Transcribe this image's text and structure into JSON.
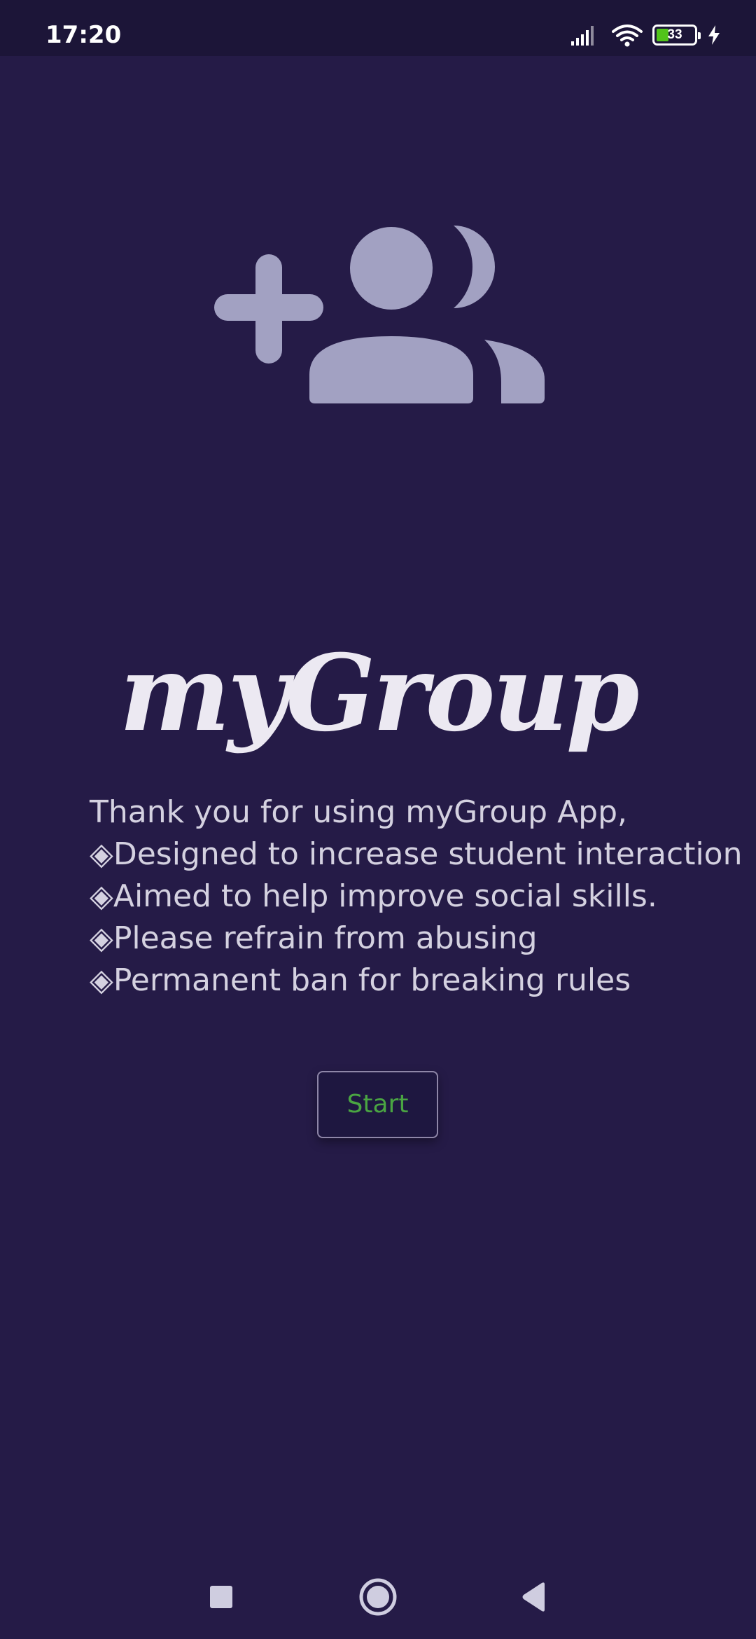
{
  "status_bar": {
    "time": "17:20",
    "battery_level": "33",
    "battery_fraction": 0.33,
    "icons": [
      "signal-icon",
      "wifi-icon",
      "battery-icon",
      "charging-bolt-icon"
    ]
  },
  "hero": {
    "icon": "group-add-icon",
    "icon_color": "#a2a1c2"
  },
  "logo": {
    "text": "myGroup"
  },
  "intro": {
    "lines": [
      "Thank you for using myGroup App,",
      "◈Designed to increase student interaction",
      "◈Aimed to help improve social skills.",
      "◈Please refrain from abusing",
      "◈Permanent ban for breaking rules"
    ]
  },
  "start_button": {
    "label": "Start"
  },
  "nav_bar": {
    "icons": [
      "recents-square-icon",
      "home-circle-icon",
      "back-triangle-icon"
    ]
  },
  "colors": {
    "background": "#251b47",
    "status_bar": "#1c1538",
    "accent_green": "#4aa542",
    "text": "#d4d1e0"
  }
}
